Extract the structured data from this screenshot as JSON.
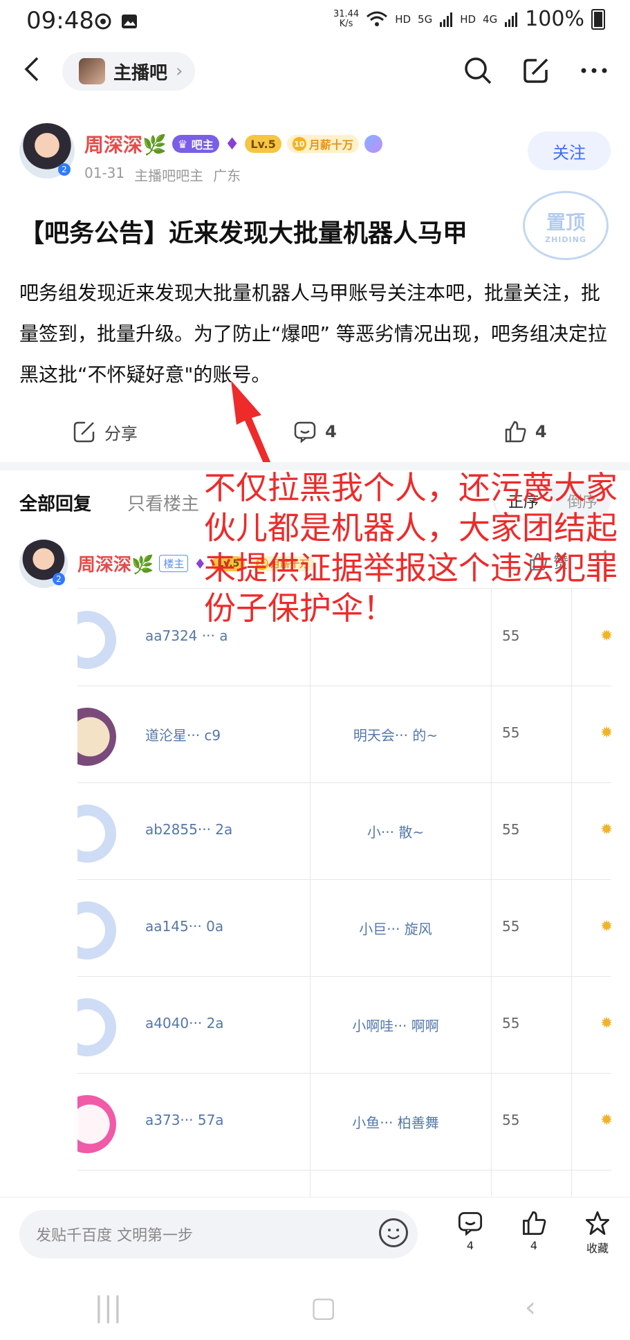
{
  "status_bar": {
    "time": "09:48",
    "net_speed_top": "31.44",
    "net_speed_bottom": "K/s",
    "hd1": "HD",
    "sig1": "5G",
    "hd2": "HD",
    "sig2": "4G",
    "battery": "100%"
  },
  "nav": {
    "forum_name": "主播吧",
    "chevron": "›",
    "back_icon": "chevron-left-icon",
    "search_icon": "search-icon",
    "share_icon": "share-icon",
    "more_icon": "more-icon"
  },
  "post": {
    "author": "周深深🌿",
    "badge_bazhu": "吧主",
    "badge_level": "Lv.5",
    "badge_salary_num": "10",
    "badge_salary": "月薪十万",
    "date": "01-31",
    "role": "主播吧吧主",
    "location": "广东",
    "follow_label": "关注",
    "title": "【吧务公告】近来发现大批量机器人马甲",
    "body": "吧务组发现近来发现大批量机器人马甲账号关注本吧，批量关注，批量签到，批量升级。为了防止“爆吧” 等恶劣情况出现，吧务组决定拉黑这批“不怀疑好意\"的账号。",
    "stamp_text": "置顶",
    "stamp_sub": "ZHIDING",
    "avatar_lz_num": "2"
  },
  "actions": {
    "share_label": "分享",
    "comment_count": "4",
    "like_count": "4"
  },
  "filter": {
    "all_replies": "全部回复",
    "only_op": "只看楼主",
    "sort_asc": "正序",
    "sort_desc": "倒序"
  },
  "reply": {
    "author": "周深深🌿",
    "op_tag": "楼主",
    "level": "Lv.5",
    "salary_num": "10",
    "salary": "月薪十万",
    "like_label": "赞",
    "more": "⋮",
    "lz_num": "2"
  },
  "table_rows": [
    {
      "name": "aa7324 ··· a",
      "nick": "",
      "level": "55"
    },
    {
      "name": "道沦星··· c9",
      "nick": "明天会··· 的~",
      "level": "55"
    },
    {
      "name": "ab2855··· 2a",
      "nick": "小··· 散~",
      "level": "55"
    },
    {
      "name": "aa145··· 0a",
      "nick": "小巨··· 旋风",
      "level": "55"
    },
    {
      "name": "a4040··· 2a",
      "nick": "小啊哇··· 啊啊",
      "level": "55"
    },
    {
      "name": "a373··· 57a",
      "nick": "小鱼··· 柏善舞",
      "level": "55"
    }
  ],
  "overlay_text": "不仅拉黑我个人，还污蔑大家伙儿都是机器人，大家团结起来提供证据举报这个违法犯罪份子保护伞！",
  "bottom_bar": {
    "input_placeholder": "发贴千百度 文明第一步",
    "comment_count": "4",
    "like_count": "4",
    "favorite_label": "收藏"
  },
  "colors": {
    "accent_blue": "#3d6ef5",
    "author_red": "#e54b4b",
    "overlay_red": "#ee2a2a"
  }
}
